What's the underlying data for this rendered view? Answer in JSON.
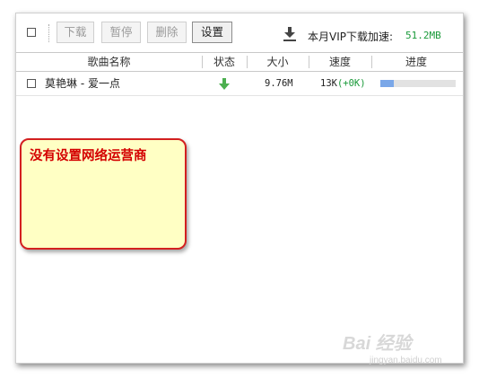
{
  "toolbar": {
    "download_label": "下载",
    "pause_label": "暂停",
    "delete_label": "删除",
    "settings_label": "设置",
    "vip_label": "本月VIP下载加速:",
    "vip_speed": "51.2MB"
  },
  "table": {
    "headers": [
      "歌曲名称",
      "状态",
      "大小",
      "速度",
      "进度"
    ],
    "rows": [
      {
        "name": "莫艳琳 - 爱一点",
        "status_icon": "download-arrow-icon",
        "size": "9.76M",
        "speed": "13K",
        "speed_extra": "(+0K)",
        "progress": 0.18
      }
    ]
  },
  "note": {
    "text": "没有设置网络运营商"
  },
  "watermark": {
    "main": "Bai 经验",
    "sub": "jingyan.baidu.com"
  },
  "colors": {
    "note_border": "#d32020",
    "note_text": "#d40000",
    "note_bg": "#ffffc4",
    "status_green": "#4caf50",
    "speed_green": "#1a9a3a",
    "progress_fill": "#7aa7e8"
  }
}
